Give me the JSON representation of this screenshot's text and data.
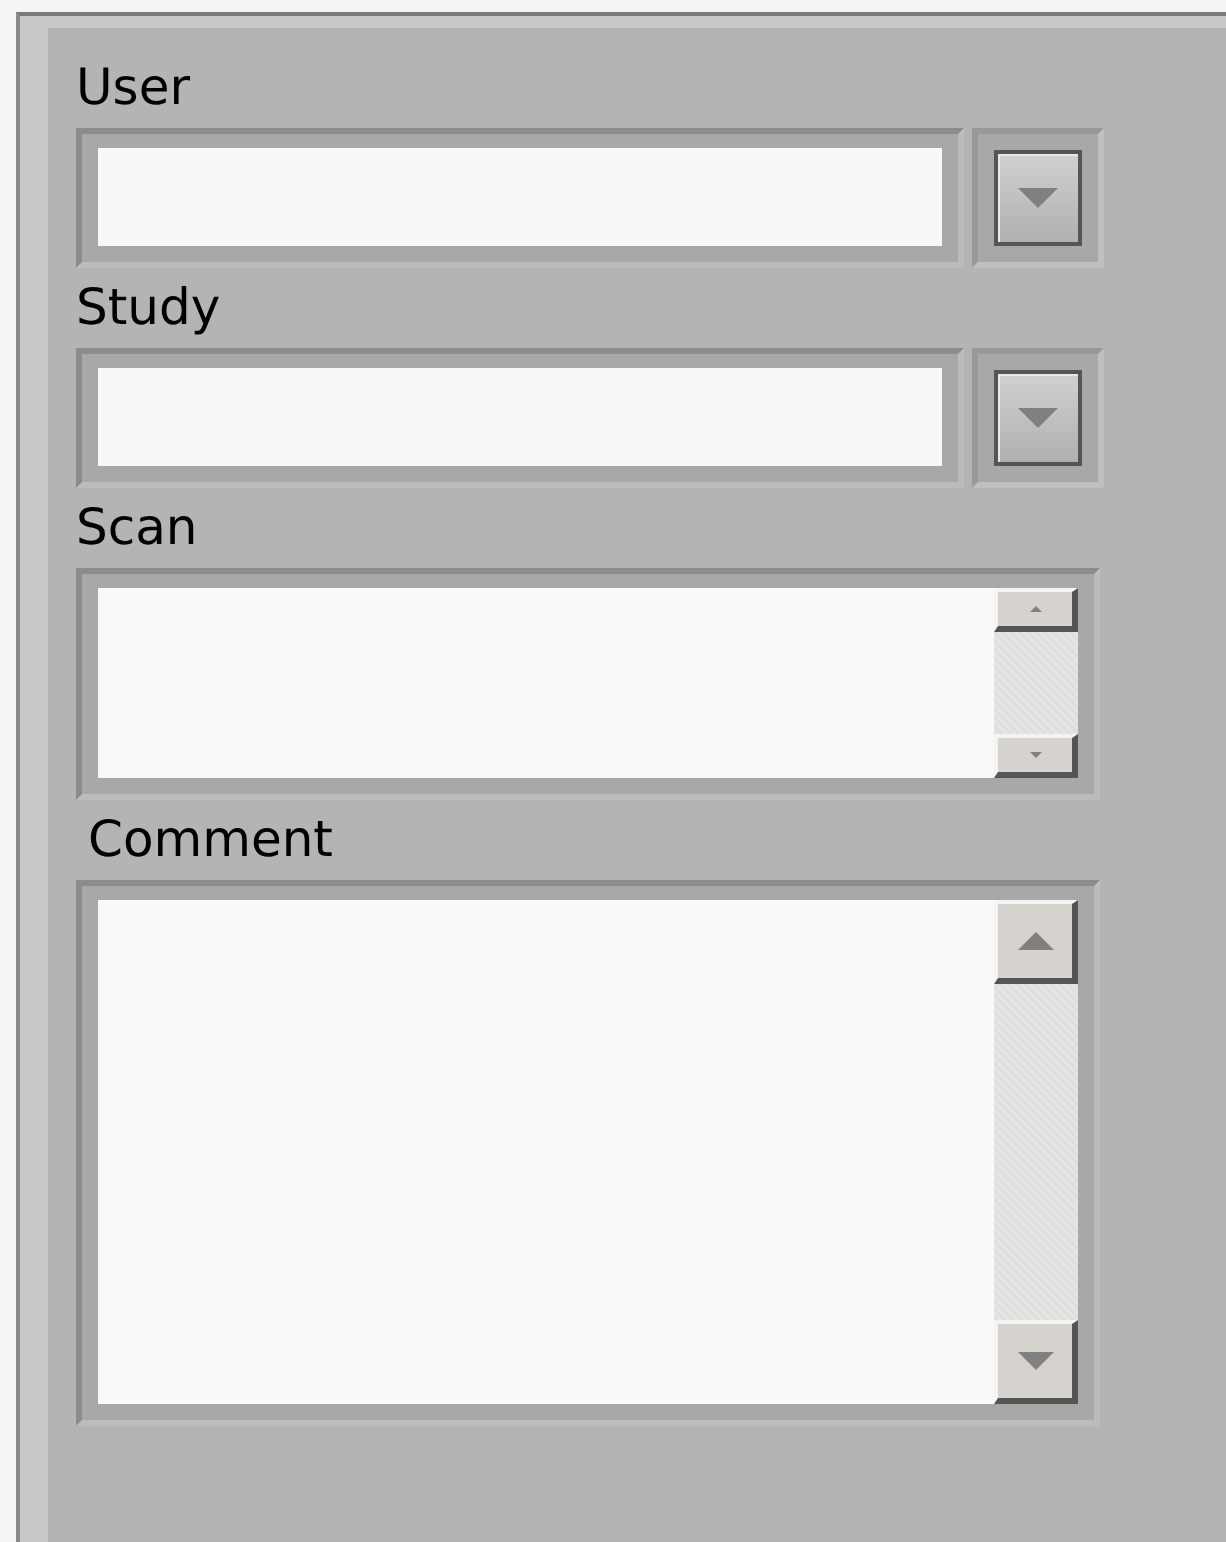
{
  "fields": [
    {
      "kind": "dropdown",
      "label": "User"
    },
    {
      "kind": "dropdown",
      "label": "Study"
    },
    {
      "kind": "list",
      "label": "Scan"
    },
    {
      "kind": "textarea",
      "label": "Comment"
    }
  ]
}
